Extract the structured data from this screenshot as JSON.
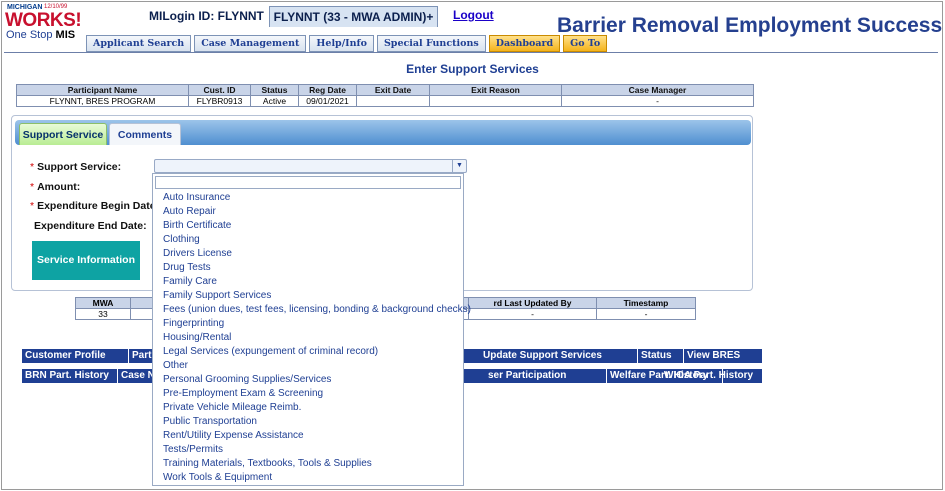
{
  "logo": {
    "state": "MICHIGAN",
    "date": "12/10/99",
    "works": "WORKS!",
    "one_stop": "One Stop",
    "mis": "MIS"
  },
  "header": {
    "milogin": "MILogin ID: FLYNNT",
    "admin": "FLYNNT (33 - MWA ADMIN)+",
    "logout": "Logout",
    "app_title": "Barrier Removal Employment Success"
  },
  "nav": [
    "Applicant Search",
    "Case Management",
    "Help/Info",
    "Special Functions",
    "Dashboard",
    "Go To"
  ],
  "page_title": "Enter Support Services",
  "participant": {
    "headers": [
      "Participant Name",
      "Cust. ID",
      "Status",
      "Reg Date",
      "Exit Date",
      "Exit Reason",
      "Case Manager"
    ],
    "row": [
      "FLYNNT, BRES PROGRAM",
      "FLYBR0913",
      "Active",
      "09/01/2021",
      "",
      "",
      "-"
    ]
  },
  "tabs": [
    "Support Service",
    "Comments"
  ],
  "form": {
    "support_service": "Support Service:",
    "amount": "Amount:",
    "begin_date": "Expenditure Begin Date:",
    "end_date": "Expenditure End Date:",
    "service_info_btn": "Service Information",
    "selected_value": ""
  },
  "mwa_table": {
    "headers": [
      "MWA",
      "",
      "rd Last Updated By",
      "Timestamp"
    ],
    "row": [
      "33",
      "",
      "-",
      "-"
    ]
  },
  "links_row1": [
    "Customer Profile",
    "Part",
    "Update Support Services",
    "Status",
    "View BRES"
  ],
  "links_row2": [
    "BRN Part. History",
    "Case No",
    "ser Participation",
    "Welfare Part. History",
    "WIOA Part. History"
  ],
  "dropdown_options": [
    "Auto Insurance",
    "Auto Repair",
    "Birth Certificate",
    "Clothing",
    "Drivers License",
    "Drug Tests",
    "Family Care",
    "Family Support Services",
    "Fees (union dues, test fees, licensing, bonding & background checks)",
    "Fingerprinting",
    "Housing/Rental",
    "Legal Services (expungement of criminal record)",
    "Other",
    "Personal Grooming Supplies/Services",
    "Pre-Employment Exam & Screening",
    "Private Vehicle Mileage Reimb.",
    "Public Transportation",
    "Rent/Utility Expense Assistance",
    "Tests/Permits",
    "Training Materials, Textbooks, Tools & Supplies",
    "Work Tools & Equipment"
  ],
  "colors": {
    "brand_blue": "#25408f",
    "link_bar": "#1f3f93",
    "accent_teal": "#0ea3a3",
    "required": "#d00000"
  }
}
